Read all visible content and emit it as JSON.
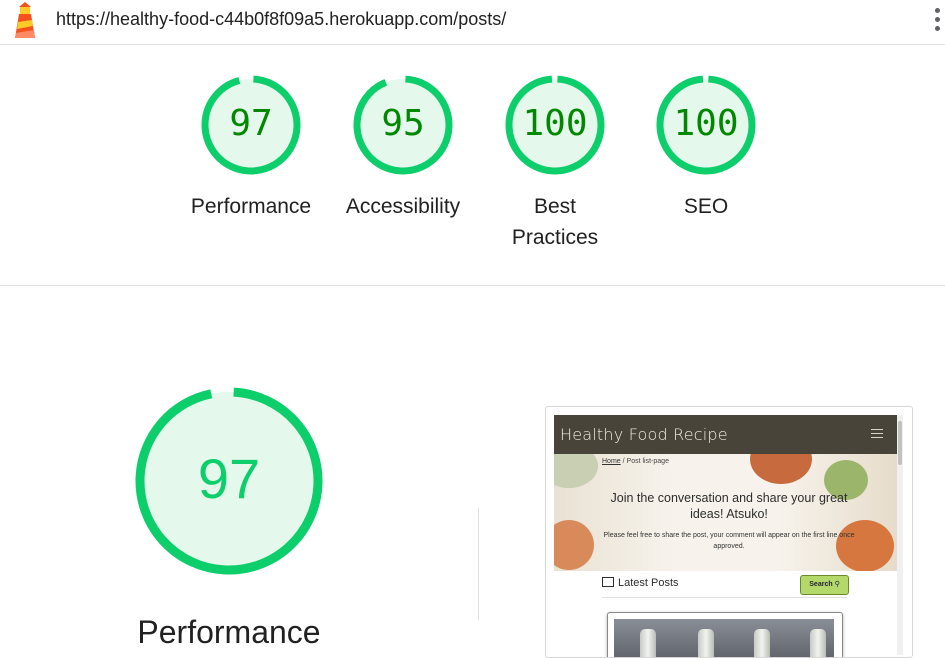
{
  "url_bar": {
    "url": "https://healthy-food-c44b0f8f09a5.herokuapp.com/posts/"
  },
  "colors": {
    "pass_green": "#0cce6b",
    "pass_text": "#008800",
    "pass_fill": "#e5f8ec"
  },
  "summary": {
    "gauges": [
      {
        "score": "97",
        "label": "Performance",
        "value": 97
      },
      {
        "score": "95",
        "label": "Accessibility",
        "value": 95
      },
      {
        "score": "100",
        "label": "Best Practices",
        "value": 100
      },
      {
        "score": "100",
        "label": "SEO",
        "value": 100
      }
    ]
  },
  "main_gauge": {
    "score": "97",
    "label": "Performance",
    "value": 97
  },
  "screenshot": {
    "brand": "Healthy Food Recipe",
    "breadcrumb_home": "Home",
    "breadcrumb_sep": "/",
    "breadcrumb_current": "Post list-page",
    "heading": "Join the conversation and share your great ideas! Atsuko!",
    "paragraph": "Please feel free to share the post, your comment will appear on the first line once approved.",
    "latest_posts": "Latest Posts",
    "search_button": "Search",
    "icons": [
      "hamburger-menu-icon",
      "newspaper-icon",
      "search-icon"
    ]
  }
}
